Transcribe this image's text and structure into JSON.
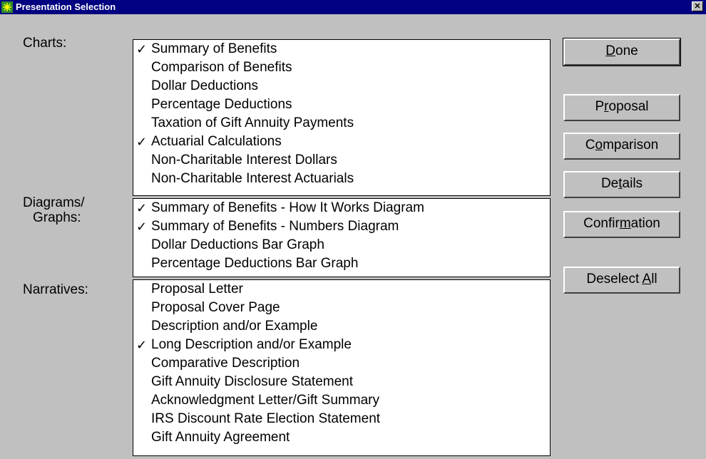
{
  "window": {
    "title": "Presentation Selection",
    "close_label": "✕"
  },
  "sections": {
    "charts_label": "Charts:",
    "diagrams_label_line1": "Diagrams/",
    "diagrams_label_line2": "Graphs:",
    "narratives_label": "Narratives:"
  },
  "charts": [
    {
      "label": "Summary of Benefits",
      "checked": true
    },
    {
      "label": "Comparison of Benefits",
      "checked": false
    },
    {
      "label": "Dollar Deductions",
      "checked": false
    },
    {
      "label": "Percentage Deductions",
      "checked": false
    },
    {
      "label": "Taxation of Gift Annuity Payments",
      "checked": false
    },
    {
      "label": "Actuarial Calculations",
      "checked": true
    },
    {
      "label": "Non-Charitable Interest Dollars",
      "checked": false
    },
    {
      "label": "Non-Charitable Interest Actuarials",
      "checked": false
    }
  ],
  "diagrams": [
    {
      "label": "Summary of Benefits - How It Works Diagram",
      "checked": true
    },
    {
      "label": "Summary of Benefits - Numbers Diagram",
      "checked": true
    },
    {
      "label": "Dollar Deductions Bar Graph",
      "checked": false
    },
    {
      "label": "Percentage Deductions Bar Graph",
      "checked": false
    }
  ],
  "narratives": [
    {
      "label": "Proposal Letter",
      "checked": false
    },
    {
      "label": "Proposal Cover Page",
      "checked": false
    },
    {
      "label": "Description and/or Example",
      "checked": false
    },
    {
      "label": "Long Description and/or Example",
      "checked": true
    },
    {
      "label": "Comparative Description",
      "checked": false
    },
    {
      "label": "Gift Annuity Disclosure Statement",
      "checked": false
    },
    {
      "label": "Acknowledgment Letter/Gift Summary",
      "checked": false
    },
    {
      "label": "IRS Discount Rate Election Statement",
      "checked": false
    },
    {
      "label": "Gift Annuity Agreement",
      "checked": false
    }
  ],
  "check_mark": "✓",
  "buttons": {
    "done": {
      "pre": "",
      "mnemonic": "D",
      "post": "one"
    },
    "proposal": {
      "pre": "P",
      "mnemonic": "r",
      "post": "oposal"
    },
    "comparison": {
      "pre": "C",
      "mnemonic": "o",
      "post": "mparison"
    },
    "details": {
      "pre": "De",
      "mnemonic": "t",
      "post": "ails"
    },
    "confirmation": {
      "pre": "Confir",
      "mnemonic": "m",
      "post": "ation"
    },
    "deselect_all": {
      "pre": "Deselect ",
      "mnemonic": "A",
      "post": "ll"
    }
  },
  "colors": {
    "titlebar": "#000080",
    "dialog_bg": "#c0c0c0",
    "list_bg": "#ffffff"
  }
}
